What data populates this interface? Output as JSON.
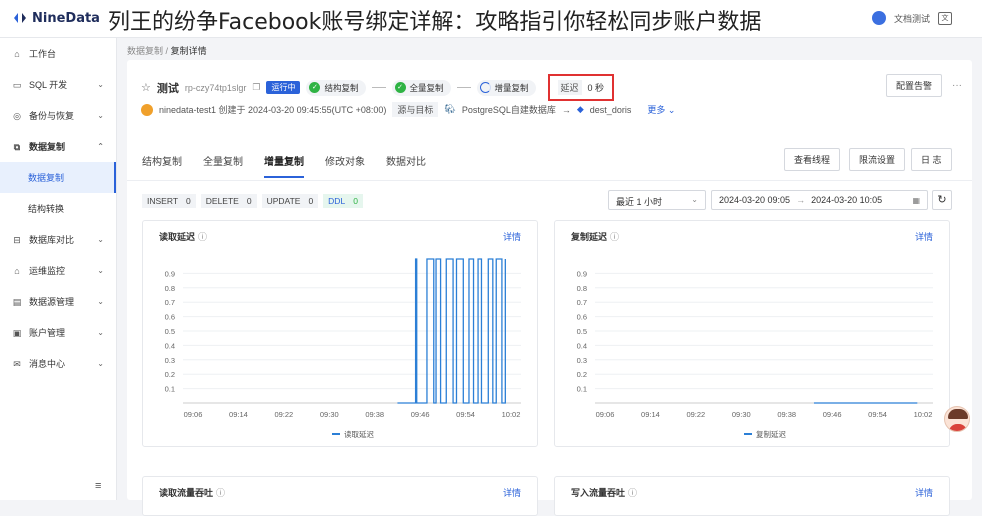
{
  "overlay_title": "列王的纷争Facebook账号绑定详解：攻略指引你轻松同步账户数据",
  "brand": {
    "name": "NineData",
    "color": "#1f2d5c",
    "accent": "#2b62d9"
  },
  "topbar": {
    "docs_label": "文档测试",
    "lang_icon": "translate-icon"
  },
  "sidebar": {
    "items": [
      {
        "label": "工作台",
        "icon": "home-icon",
        "chev": ""
      },
      {
        "label": "SQL 开发",
        "icon": "sql-icon",
        "chev": "⌄"
      },
      {
        "label": "备份与恢复",
        "icon": "backup-icon",
        "chev": "⌄"
      },
      {
        "label": "数据复制",
        "icon": "replication-icon",
        "chev": "⌃"
      }
    ],
    "subitems": [
      {
        "label": "数据复制"
      },
      {
        "label": "结构转换"
      }
    ],
    "items2": [
      {
        "label": "数据库对比",
        "icon": "compare-icon",
        "chev": "⌄"
      },
      {
        "label": "运维监控",
        "icon": "monitor-icon",
        "chev": "⌄"
      },
      {
        "label": "数据源管理",
        "icon": "datasource-icon",
        "chev": "⌄"
      },
      {
        "label": "账户管理",
        "icon": "account-icon",
        "chev": "⌄"
      },
      {
        "label": "消息中心",
        "icon": "message-icon",
        "chev": "⌄"
      }
    ],
    "collapse_icon": "≡"
  },
  "breadcrumb": {
    "parent": "数据复制",
    "sep": "/",
    "current": "复制详情"
  },
  "task": {
    "star": "☆",
    "name": "测试",
    "id": "rp-czy74tp1slgr",
    "status": "运行中",
    "stages": [
      "结构复制",
      "全量复制",
      "增量复制"
    ],
    "latency_label": "延迟",
    "latency_value": "0 秒",
    "alarm_button": "配置告警",
    "more": "···",
    "creator": "ninedata-test1 创建于 2024-03-20 09:45:55(UTC +08:00)",
    "src_tag": "源与目标",
    "source": "PostgreSQL自建数据库",
    "arrow": "→",
    "target": "dest_doris",
    "more_link": "更多 ⌄"
  },
  "tabs": [
    "结构复制",
    "全量复制",
    "增量复制",
    "修改对象",
    "数据对比"
  ],
  "tab_buttons": {
    "threads": "查看线程",
    "throttle": "限流设置",
    "logs": "日 志"
  },
  "counters": [
    {
      "label": "INSERT",
      "value": "0"
    },
    {
      "label": "DELETE",
      "value": "0"
    },
    {
      "label": "UPDATE",
      "value": "0"
    },
    {
      "label": "DDL",
      "value": "0"
    }
  ],
  "time_select": "最近 1 小时",
  "range": {
    "start": "2024-03-20 09:05",
    "arrow": "→",
    "end": "2024-03-20 10:05"
  },
  "panels": {
    "read_latency": {
      "title": "读取延迟",
      "link": "详情"
    },
    "copy_latency": {
      "title": "复制延迟",
      "link": "详情"
    },
    "read_throughput": {
      "title": "读取流量吞吐",
      "link": "详情"
    },
    "write_throughput": {
      "title": "写入流量吞吐",
      "link": "详情"
    }
  },
  "chart_data": [
    {
      "type": "line",
      "x_ticks": [
        "09:06",
        "09:14",
        "09:22",
        "09:30",
        "09:38",
        "09:46",
        "09:54",
        "10:02"
      ],
      "ylim": [
        0,
        1
      ],
      "y_ticks": [
        "0.9",
        "0.8",
        "0.7",
        "0.6",
        "0.5",
        "0.4",
        "0.3",
        "0.2",
        "0.1"
      ],
      "series": [
        {
          "name": "读取延迟",
          "color": "#2b7fd6",
          "x": [
            9.0,
            9.8,
            9.85,
            10.3,
            10.6,
            10.7,
            10.9,
            11.15,
            11.45,
            11.6,
            11.9,
            12.15,
            12.35,
            12.55,
            12.7,
            13.0,
            13.2,
            13.35,
            13.6,
            13.75
          ],
          "y": [
            0,
            1,
            0,
            1,
            0,
            1,
            0,
            1,
            0,
            1,
            0,
            1,
            0,
            1,
            0,
            1,
            0,
            1,
            0,
            1
          ]
        }
      ]
    },
    {
      "type": "line",
      "x_ticks": [
        "09:06",
        "09:14",
        "09:22",
        "09:30",
        "09:38",
        "09:46",
        "09:54",
        "10:02"
      ],
      "ylim": [
        0,
        1
      ],
      "y_ticks": [
        "0.9",
        "0.8",
        "0.7",
        "0.6",
        "0.5",
        "0.4",
        "0.3",
        "0.2",
        "0.1"
      ],
      "series": [
        {
          "name": "复制延迟",
          "color": "#2b7fd6",
          "x": [
            9.2,
            13.75
          ],
          "y": [
            0,
            0
          ]
        }
      ]
    }
  ]
}
